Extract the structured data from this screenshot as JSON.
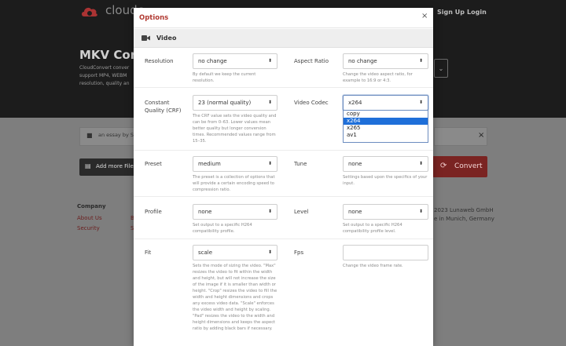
{
  "background": {
    "brand": "cloudc",
    "nav": {
      "signup": "Sign Up",
      "login": "Login"
    },
    "title": "MKV Conv",
    "description": "CloudConvert conver support MP4, WEBM resolution, quality an",
    "file_name": "an essay by S",
    "add_more_label": "Add more File",
    "convert_label": "Convert",
    "footer": {
      "company_heading": "Company",
      "links": [
        "About Us",
        "Security"
      ],
      "mid_letters": [
        "B",
        "S"
      ],
      "copyright": "2023 Lunaweb GmbH",
      "made_in": "e in Munich, Germany"
    }
  },
  "modal": {
    "title": "Options",
    "close": "×",
    "section": "Video",
    "fields": {
      "resolution": {
        "label": "Resolution",
        "value": "no change",
        "help": "By default we keep the current resolution."
      },
      "aspect_ratio": {
        "label": "Aspect Ratio",
        "value": "no change",
        "help": "Change the video aspect ratio, for example to 16:9 or 4:3."
      },
      "crf": {
        "label": "Constant Quality (CRF)",
        "value": "23 (normal quality)",
        "help": "The CRF value sets the video quality and can be from 0–63. Lower values mean better quality but longer conversion times. Recommended values range from 15–35."
      },
      "video_codec": {
        "label": "Video Codec",
        "value": "x264",
        "options": [
          "copy",
          "x264",
          "x265",
          "av1"
        ],
        "highlighted": "x264"
      },
      "preset": {
        "label": "Preset",
        "value": "medium",
        "help": "The preset is a collection of options that will provide a certain encoding speed to compression ratio."
      },
      "tune": {
        "label": "Tune",
        "value": "none",
        "help": "Settings based upon the specifics of your input."
      },
      "profile": {
        "label": "Profile",
        "value": "none",
        "help": "Set output to a specific H264 compatibility profile."
      },
      "level": {
        "label": "Level",
        "value": "none",
        "help": "Set output to a specific H264 compatibility profile level."
      },
      "fit": {
        "label": "Fit",
        "value": "scale",
        "help": "Sets the mode of sizing the video. \"Max\" resizes the video to fit within the width and height, but will not increase the size of the image if it is smaller than width or height. \"Crop\" resizes the video to fill the width and height dimensions and crops any excess video data. \"Scale\" enforces the video width and height by scaling. \"Pad\" resizes the video to the width and height dimensions and keeps the aspect ratio by adding black bars if necessary."
      },
      "fps": {
        "label": "Fps",
        "value": "",
        "help": "Change the video frame rate."
      }
    }
  },
  "colors": {
    "accent": "#b13a32",
    "convert": "#7a2422",
    "dropdown_highlight": "#1e6fd9"
  }
}
